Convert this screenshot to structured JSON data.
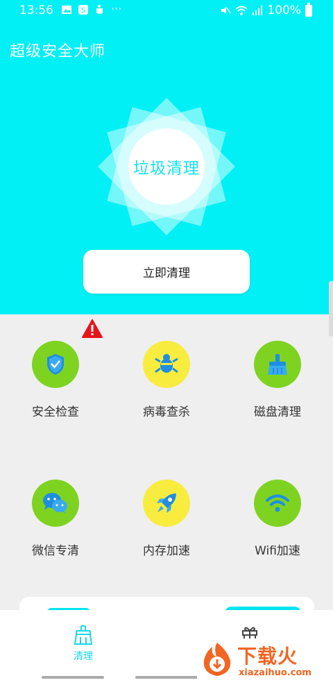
{
  "status_bar": {
    "time": "13:56",
    "battery": "100%",
    "left_icons": [
      "gallery-icon",
      "app-icon",
      "cup-icon",
      "more-dots-icon"
    ],
    "right_icons": [
      "mute-icon",
      "wifi-icon",
      "signal-icon",
      "battery-icon"
    ]
  },
  "header": {
    "title": "超级安全大师"
  },
  "hero": {
    "center_label": "垃圾清理",
    "action_button": "立即清理",
    "accent_color": "#00f0f5"
  },
  "features": [
    {
      "label": "安全检查",
      "icon": "shield-check-icon",
      "color": "#7ed321",
      "warning": true
    },
    {
      "label": "病毒查杀",
      "icon": "bug-icon",
      "color": "#f8ec3f"
    },
    {
      "label": "磁盘清理",
      "icon": "broom-icon",
      "color": "#7ed321"
    },
    {
      "label": "微信专清",
      "icon": "wechat-icon",
      "color": "#7ed321"
    },
    {
      "label": "内存加速",
      "icon": "rocket-icon",
      "color": "#f8ec3f"
    },
    {
      "label": "Wifi加速",
      "icon": "wifi-icon",
      "color": "#7ed321"
    }
  ],
  "bottom_nav": {
    "tabs": [
      {
        "label": "清理",
        "icon": "broom-tab-icon",
        "active": true
      },
      {
        "label": "",
        "icon": "gift-icon",
        "active": false
      }
    ]
  },
  "watermark": {
    "brand": "下载火",
    "url": "xiazaihuo.com"
  }
}
